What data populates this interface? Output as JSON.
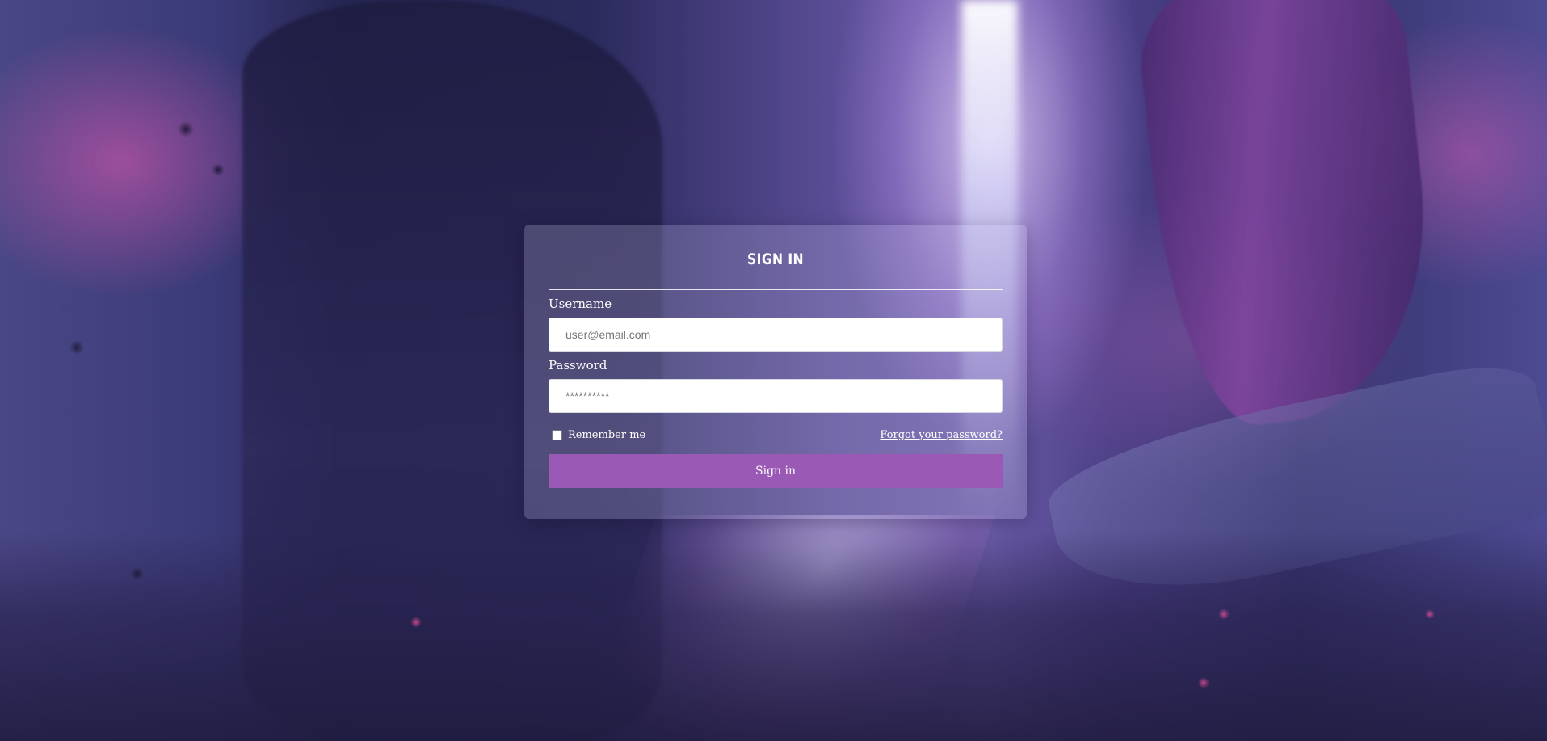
{
  "colors": {
    "accent": "#9b59b6",
    "card_bg": "rgba(200,195,235,0.24)",
    "text": "#ffffff"
  },
  "form": {
    "title": "SIGN IN",
    "username": {
      "label": "Username",
      "placeholder": "user@email.com",
      "value": ""
    },
    "password": {
      "label": "Password",
      "placeholder": "**********",
      "value": ""
    },
    "remember_label": "Remember me",
    "remember_checked": false,
    "forgot_label": "Forgot your password?",
    "submit_label": "Sign in"
  }
}
